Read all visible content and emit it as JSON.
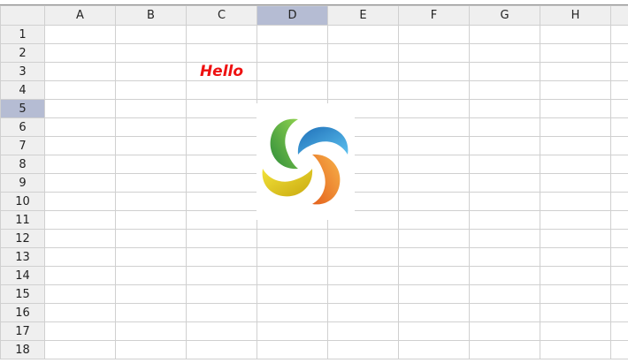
{
  "spreadsheet": {
    "columns": [
      "A",
      "B",
      "C",
      "D",
      "E",
      "F",
      "G",
      "H"
    ],
    "rows": [
      "1",
      "2",
      "3",
      "4",
      "5",
      "6",
      "7",
      "8",
      "9",
      "10",
      "11",
      "12",
      "13",
      "14",
      "15",
      "16",
      "17",
      "18"
    ],
    "selected_column": "D",
    "selected_row": "5",
    "cells": {
      "C3": "Hello"
    }
  },
  "image": {
    "icon": "swirl-logo",
    "colors": [
      "#2f9ad6",
      "#f28a2e",
      "#e8d11e",
      "#3aa545"
    ]
  },
  "colors": {
    "header_bg": "#efefef",
    "header_selected_bg": "#b5bcd3",
    "grid_line": "#d0d0d0",
    "hello_text": "#ee1111"
  }
}
